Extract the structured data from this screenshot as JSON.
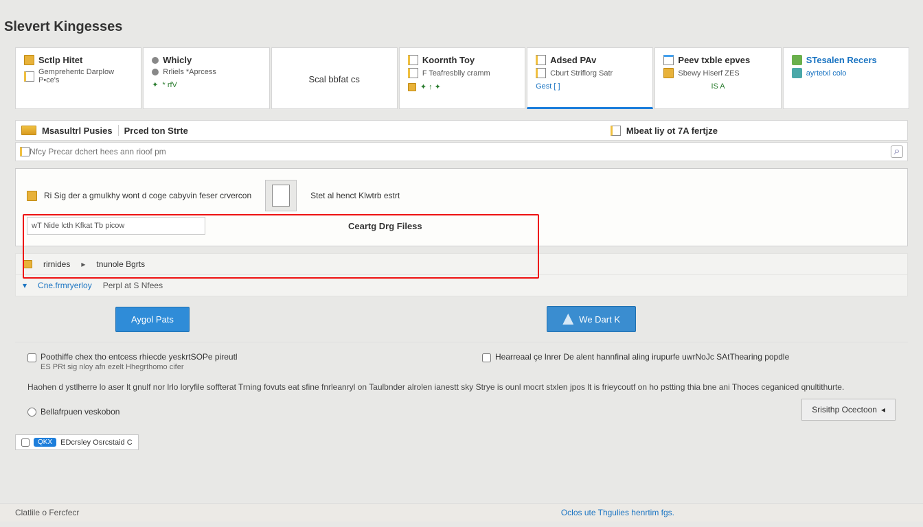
{
  "title": "Slevert Kingesses",
  "tabs": [
    {
      "title": "Sctlp Hitet",
      "sub": "Gemprehentc  Darplow P•ce's",
      "metric": ""
    },
    {
      "title": "Whicly",
      "sub": "Rrliels  *Aprcess",
      "metric": "* rfV"
    },
    {
      "title": "Scal bbfat cs",
      "sub": "",
      "metric": ""
    },
    {
      "title": "Koornth Toy",
      "sub": "F Teafresblly cramm",
      "metric": "✦  ↑  ✦"
    },
    {
      "title": "Adsed PAv",
      "sub": "Cburt Striflorg Satr",
      "metric": "Gest  [ ]"
    },
    {
      "title": "Peev txble epves",
      "sub": "Sbewy Hiserf ZES",
      "metric": "IS A"
    },
    {
      "title": "STesalen Recers",
      "sub": "ayrtetxl colo",
      "metric": ""
    }
  ],
  "bar": {
    "left": "Msasultrl Pusies",
    "right": "Prced ton Strte",
    "far": "Mbeat liy ot 7A fertjze"
  },
  "search": {
    "placeholder": "Nfcy Precar dchert hees ann rioof pm"
  },
  "panel": {
    "hint": "Ri Sig der a gmulkhy wont d coge cabyvin feser crvercon",
    "secLabel": "Stet al henct Klwtrb estrt",
    "dropTitle": "Ceartg Drg Filess",
    "inputText": "wT Nide lcth Kfkat Tb picow"
  },
  "tags": {
    "a": "rirnides",
    "b": "tnunole Bgrts",
    "c": "Cne.frmryerloy",
    "d": "Perpl at S Nfees"
  },
  "buttons": {
    "apply": "Aygol Pats",
    "wedart": "We Dart K"
  },
  "lower": {
    "chk1": "Poothiffe chex tho entcess rhiecde yeskrtSOPe pireutl",
    "chk1b": "ES PRt sig nloy afn ezelt Hhegrthomo cifer",
    "chk2": "Hearreaal çe lnrer De alent hannfinal aling irupurfe uwrNoJc SAtThearing popdle",
    "para": "Haohen d ystlherre lo aser lt gnulf nor lrlo loryfile soffterat Trning fovuts eat sfine fnrleanryl on Taulbnder alrolen ianestt sky Strye is ounl mocrt stxlen jpos lt is frieycoutf on ho pstting thia bne ani Thoces ceganiced qnultithurte.",
    "radio": "Bellafrpuen veskobon",
    "sidebtn": "Srisithp Ocectoon",
    "badge": "EDcrsley Osrcstaid C"
  },
  "footer": {
    "left": "Clatlile o Fercfecr",
    "link": "Oclos ute Thgulies henrtim fgs."
  }
}
